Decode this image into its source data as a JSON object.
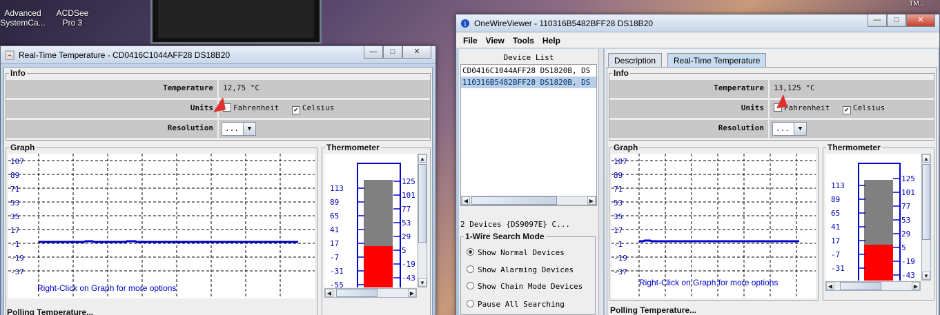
{
  "desktop": {
    "icons": [
      {
        "label": "Advanced SystemCa..."
      },
      {
        "label": "ACDSee Pro 3"
      }
    ],
    "tray_label": "TM..."
  },
  "left_window": {
    "title": "Real-Time Temperature - CD0416C1044AFF28 DS18B20",
    "info_legend": "Info",
    "temperature_label": "Temperature",
    "temperature_value": "12,75 °C",
    "units_label": "Units",
    "fahrenheit_label": "Fahrenheit",
    "celsius_label": "Celsius",
    "fahrenheit_checked": false,
    "celsius_checked": true,
    "resolution_label": "Resolution",
    "resolution_value": "...",
    "graph_legend": "Graph",
    "graph_yticks": [
      "107",
      "89",
      "71",
      "53",
      "35",
      "17",
      "-1",
      "-19",
      "-37"
    ],
    "graph_hint": "Right-Click on Graph for more options",
    "thermo_legend": "Thermometer",
    "thermo_left_ticks": [
      "113",
      "89",
      "65",
      "41",
      "17",
      "-7",
      "-31",
      "-55"
    ],
    "thermo_right_ticks": [
      "125",
      "101",
      "77",
      "53",
      "29",
      "5",
      "-19",
      "-43"
    ],
    "status": "Polling Temperature..."
  },
  "right_window": {
    "title": "OneWireViewer - 110316B5482BFF28 DS18B20",
    "menu": [
      "File",
      "View",
      "Tools",
      "Help"
    ],
    "device_list_title": "Device List",
    "devices": [
      "CD0416C1044AFF28 DS1820B, DS",
      "110316B5482BFF28 DS1820B, DS"
    ],
    "selected_device_index": 1,
    "device_count": "2 Devices  {DS9097E} C...",
    "search_mode_legend": "1-Wire Search Mode",
    "search_modes": [
      "Show Normal Devices",
      "Show Alarming Devices",
      "Show Chain Mode Devices",
      "Pause All Searching"
    ],
    "search_mode_selected": 0,
    "tabs": [
      "Description",
      "Real-Time Temperature"
    ],
    "active_tab": 1,
    "info_legend": "Info",
    "temperature_label": "Temperature",
    "temperature_value": "13,125 °C",
    "units_label": "Units",
    "fahrenheit_label": "Fahrenheit",
    "celsius_label": "Celsius",
    "fahrenheit_checked": false,
    "celsius_checked": true,
    "resolution_label": "Resolution",
    "resolution_value": "...",
    "graph_legend": "Graph",
    "graph_yticks": [
      "107",
      "89",
      "71",
      "53",
      "35",
      "17",
      "-1",
      "-19",
      "-37"
    ],
    "graph_hint": "Right-Click on Graph for more options",
    "thermo_legend": "Thermometer",
    "thermo_left_ticks": [
      "113",
      "89",
      "65",
      "41",
      "17",
      "-7",
      "-31"
    ],
    "thermo_right_ticks": [
      "125",
      "101",
      "77",
      "53",
      "29",
      "5",
      "-19",
      "-43"
    ],
    "status": "Polling Temperature..."
  },
  "colors": {
    "series_line": "#0000cc",
    "thermo_fill": "#ff0000",
    "thermo_empty": "#808080",
    "thermo_frame": "#0000cc"
  }
}
